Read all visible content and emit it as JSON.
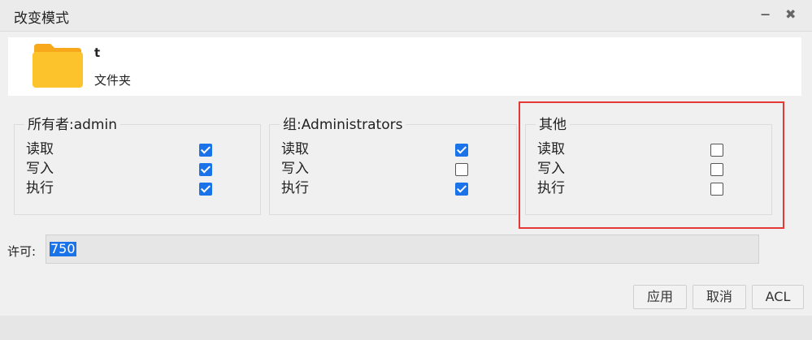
{
  "window": {
    "title": "改变模式",
    "minimize_glyph": "−",
    "close_glyph": "✖"
  },
  "file": {
    "name": "t",
    "type": "文件夹",
    "icon": "folder-icon"
  },
  "groups": [
    {
      "title": "所有者:admin",
      "perms": [
        {
          "label": "读取",
          "checked": true
        },
        {
          "label": "写入",
          "checked": true
        },
        {
          "label": "执行",
          "checked": true
        }
      ]
    },
    {
      "title": "组:Administrators",
      "perms": [
        {
          "label": "读取",
          "checked": true
        },
        {
          "label": "写入",
          "checked": false
        },
        {
          "label": "执行",
          "checked": true
        }
      ]
    },
    {
      "title": "其他",
      "perms": [
        {
          "label": "读取",
          "checked": false
        },
        {
          "label": "写入",
          "checked": false
        },
        {
          "label": "执行",
          "checked": false
        }
      ]
    }
  ],
  "permission": {
    "label": "许可:",
    "value": "750"
  },
  "buttons": {
    "apply": "应用",
    "cancel": "取消",
    "acl": "ACL"
  },
  "colors": {
    "accent": "#1a73e8",
    "highlight": "#e53935"
  }
}
